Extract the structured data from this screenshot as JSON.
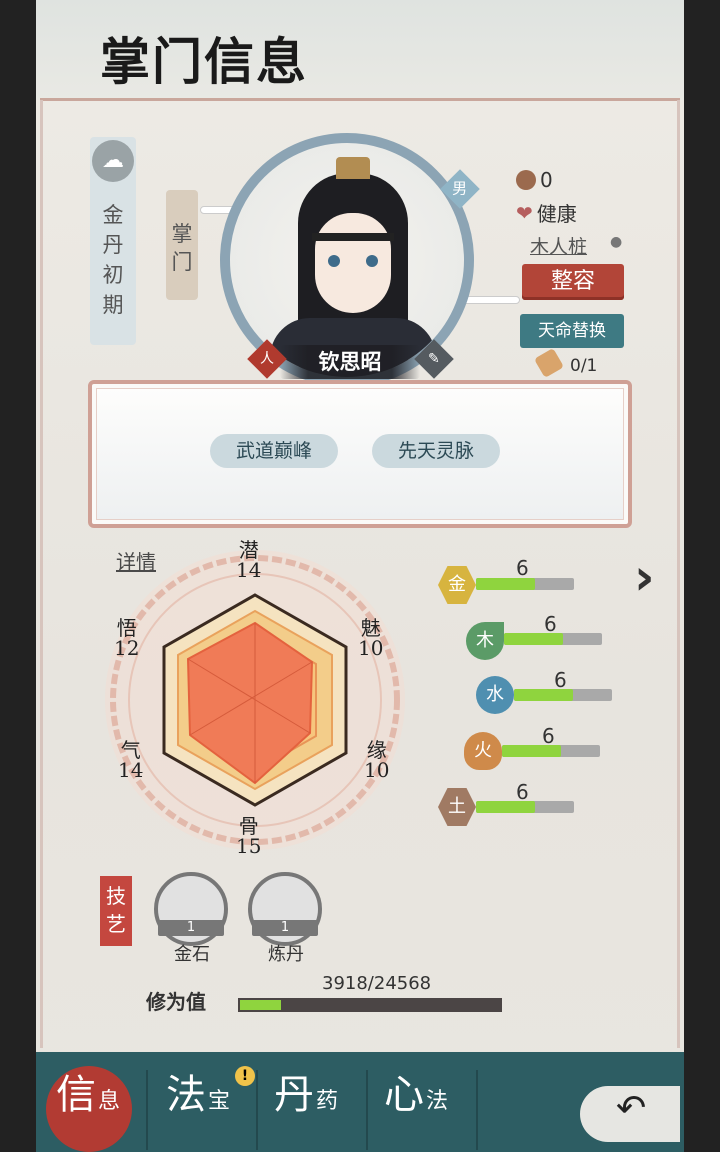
{
  "header": {
    "title": "掌门信息"
  },
  "character": {
    "realm": "金丹初期",
    "role": "掌门",
    "gender": "男",
    "name": "钦思昭",
    "badge_left": "人",
    "coins": "0",
    "health": "健康",
    "location": "木人桩",
    "btn_makeover": "整容",
    "btn_fate_swap": "天命替换",
    "fate_count": "0/1"
  },
  "traits": [
    "武道巅峰",
    "先天灵脉"
  ],
  "attributes": {
    "details_link": "详情",
    "qian": {
      "label": "潜",
      "value": "14"
    },
    "mei": {
      "label": "魅",
      "value": "10"
    },
    "yuan": {
      "label": "缘",
      "value": "10"
    },
    "gu": {
      "label": "骨",
      "value": "15"
    },
    "qi": {
      "label": "气",
      "value": "14"
    },
    "wu": {
      "label": "悟",
      "value": "12"
    }
  },
  "elements": [
    {
      "name": "金",
      "value": "6",
      "color": "#d7b43f"
    },
    {
      "name": "木",
      "value": "6",
      "color": "#5b9b67"
    },
    {
      "name": "水",
      "value": "6",
      "color": "#4f8fb0"
    },
    {
      "name": "火",
      "value": "6",
      "color": "#cf8a4a"
    },
    {
      "name": "土",
      "value": "6",
      "color": "#a07a63"
    }
  ],
  "skills": {
    "section_label": "技艺",
    "items": [
      {
        "name": "金石",
        "level": "1"
      },
      {
        "name": "炼丹",
        "level": "1"
      }
    ]
  },
  "cultivation": {
    "label": "修为值",
    "value": "3918/24568",
    "progress": 0.159
  },
  "tabs": [
    {
      "big": "信",
      "small": "息"
    },
    {
      "big": "法",
      "small": "宝"
    },
    {
      "big": "丹",
      "small": "药"
    },
    {
      "big": "心",
      "small": "法"
    }
  ],
  "colors": {
    "accent_red": "#b24538",
    "teal": "#3e7a83",
    "bar_green": "#8fd43e",
    "tabbar": "#2d5d63"
  }
}
